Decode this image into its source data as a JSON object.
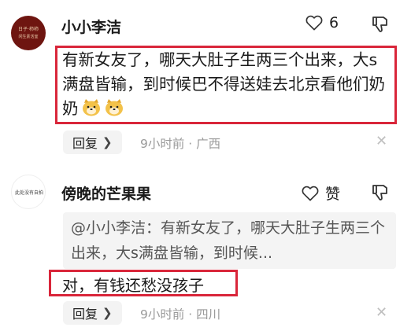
{
  "comments": [
    {
      "username": "小小李洁",
      "likes": "6",
      "text": "有新女友了，哪天大肚子生两三个出来，大s满盘皆输，到时候巴不得送娃去北京看他们奶奶",
      "emojis": [
        "doge-emoji",
        "doge-emoji"
      ],
      "reply_label": "回复",
      "meta": "9小时前 · 广西",
      "avatar_text": "日子·柿柿 闲生素活室"
    },
    {
      "username": "傍晚的芒果果",
      "likes": "赞",
      "quote": "@小小李洁：有新女友了，哪天大肚子生两三个出来，大s满盘皆输，到时候...",
      "text": "对，有钱还愁没孩子",
      "reply_label": "回复",
      "meta": "9小时前 · 四川",
      "avatar_text": "此处没有自拍"
    }
  ],
  "icons": {
    "like": "heart-outline-icon",
    "dislike": "thumbs-down-icon",
    "close": "close-icon",
    "reply_chevron": "chevron-right-icon"
  },
  "colors": {
    "highlight": "#d9263a",
    "meta": "#9a9a9a",
    "avatar1_bg": "#6e1510"
  }
}
